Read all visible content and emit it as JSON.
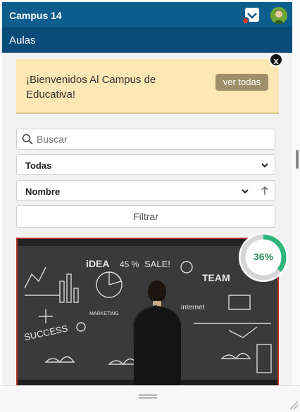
{
  "header": {
    "app_title": "Campus 14",
    "notification_icon": "inbox-check-icon",
    "avatar_icon": "user-avatar-icon"
  },
  "subheader": {
    "section_title": "Aulas"
  },
  "banner": {
    "message": "¡Bienvenidos Al Campus de Educativa!",
    "button_label": "ver todas",
    "close_glyph": "x"
  },
  "filters": {
    "search_placeholder": "Buscar",
    "category_selected": "Todas",
    "sort_selected": "Nombre",
    "filter_button": "Filtrar"
  },
  "course": {
    "progress_label": "36%",
    "progress_value": 0.36,
    "image_words": [
      "iDEA",
      "45 %",
      "SALE!",
      "TEAM",
      "MARKETING",
      "SUCCESS",
      "internet"
    ]
  },
  "colors": {
    "header_bg": "#0e5d8f",
    "subheader_bg": "#0a4c79",
    "banner_bg": "#fde7b5",
    "banner_button": "#9e8f6a",
    "progress": "#2fb67c",
    "card_border": "#b5332a"
  }
}
